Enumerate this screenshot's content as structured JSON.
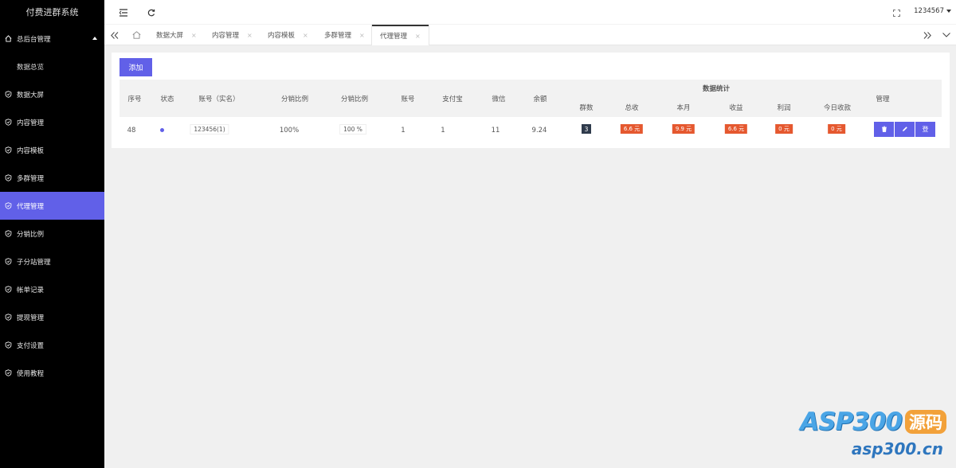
{
  "sidebar": {
    "logo": "付费进群系统",
    "items": [
      {
        "label": "总后台管理",
        "icon": "home-icon"
      },
      {
        "label": "数据总览"
      },
      {
        "label": "数据大屏",
        "icon": "shield-check-icon"
      },
      {
        "label": "内容管理",
        "icon": "shield-check-icon"
      },
      {
        "label": "内容模板",
        "icon": "shield-check-icon"
      },
      {
        "label": "多群管理",
        "icon": "shield-check-icon"
      },
      {
        "label": "代理管理",
        "icon": "shield-check-icon"
      },
      {
        "label": "分销比例",
        "icon": "shield-check-icon"
      },
      {
        "label": "子分站管理",
        "icon": "shield-check-icon"
      },
      {
        "label": "帐单记录",
        "icon": "shield-check-icon"
      },
      {
        "label": "提现管理",
        "icon": "shield-check-icon"
      },
      {
        "label": "支付设置",
        "icon": "shield-check-icon"
      },
      {
        "label": "使用教程",
        "icon": "shield-check-icon"
      }
    ]
  },
  "header": {
    "user": "1234567"
  },
  "tabs": [
    {
      "label": "数据大屏"
    },
    {
      "label": "内容管理"
    },
    {
      "label": "内容模板"
    },
    {
      "label": "多群管理"
    },
    {
      "label": "代理管理"
    }
  ],
  "tab_close": "×",
  "toolbar": {
    "add_label": "添加"
  },
  "table": {
    "headers": {
      "index": "序号",
      "status": "状态",
      "account_name": "账号（实名）",
      "ratio1": "分销比例",
      "ratio2": "分销比例",
      "account": "账号",
      "alipay": "支付宝",
      "wechat": "微信",
      "balance": "余额",
      "stats_group": "数据统计",
      "groups": "群数",
      "total": "总收",
      "month": "本月",
      "income": "收益",
      "profit": "利润",
      "today": "今日收款",
      "manage": "管理"
    },
    "rows": [
      {
        "index": "48",
        "account_name": "123456(1)",
        "ratio1": "100%",
        "ratio2": "100 %",
        "account": "1",
        "alipay": "1",
        "wechat": "11",
        "balance": "9.24",
        "groups": "3",
        "total": "6.6 元",
        "month": "9.9 元",
        "income": "6.6 元",
        "profit": "0 元",
        "today": "0 元",
        "actions": {
          "delete_icon": "trash-icon",
          "edit_icon": "pencil-icon",
          "login_label": "登"
        }
      }
    ]
  },
  "watermark": {
    "brand": "ASP300",
    "tag": "源码",
    "url": "asp300.cn"
  },
  "colors": {
    "accent": "#6160e8",
    "sidebar_bg": "#000000",
    "badge_red": "#e5582f",
    "badge_dark": "#2f3b4c"
  }
}
